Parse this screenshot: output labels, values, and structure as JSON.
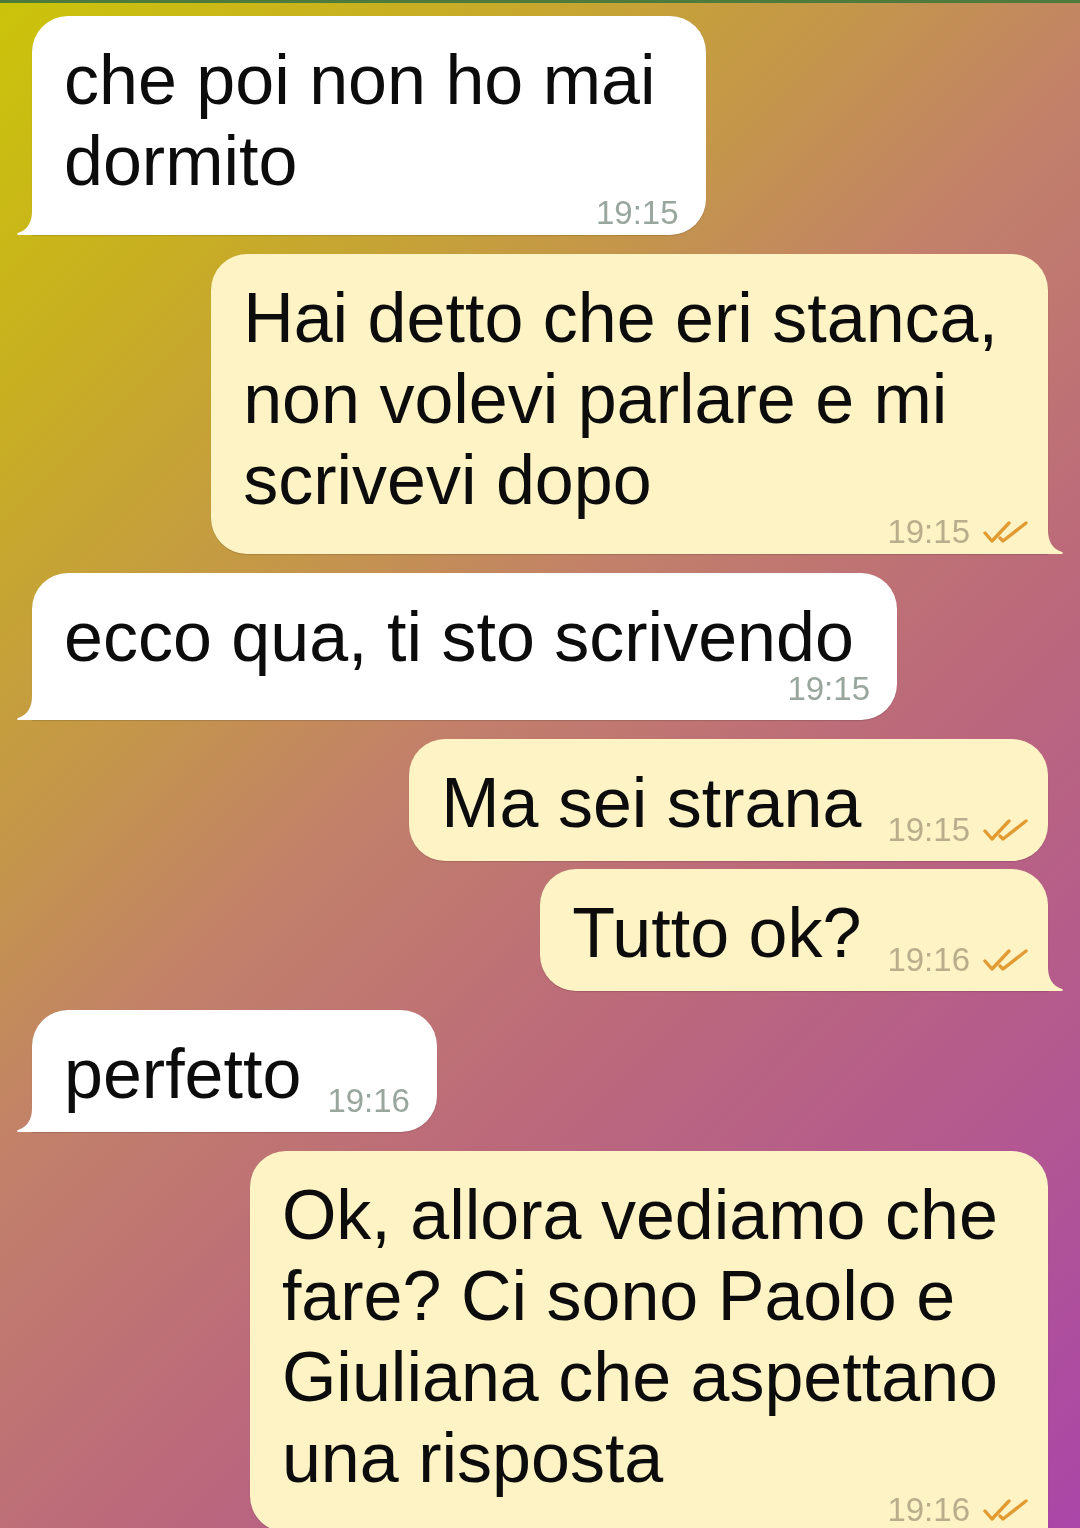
{
  "messages": [
    {
      "kind": "incoming",
      "text": "che poi non ho mai\ndormito",
      "time": "19:15"
    },
    {
      "kind": "outgoing",
      "text": "Hai detto che eri stanca,\nnon volevi parlare e mi\nscrivevi dopo",
      "time": "19:15",
      "read": true
    },
    {
      "kind": "incoming",
      "text": "ecco qua, ti sto scrivendo",
      "time": "19:15"
    },
    {
      "kind": "outgoing",
      "text": "Ma sei strana",
      "time": "19:15",
      "read": true
    },
    {
      "kind": "outgoing",
      "text": "Tutto ok?",
      "time": "19:16",
      "read": true
    },
    {
      "kind": "incoming",
      "text": "perfetto",
      "time": "19:16"
    },
    {
      "kind": "outgoing",
      "text": "Ok, allora vediamo che\nfare? Ci sono Paolo e\nGiuliana che aspettano\nuna risposta",
      "time": "19:16",
      "read": true
    }
  ]
}
